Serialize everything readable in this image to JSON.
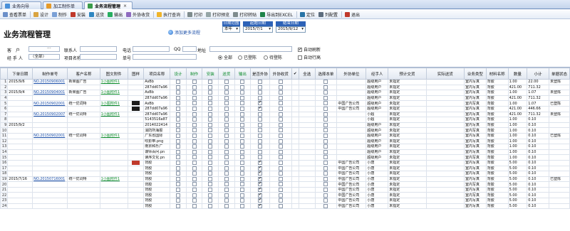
{
  "tabs": [
    {
      "label": "业务向导",
      "active": false
    },
    {
      "label": "加工制作单",
      "active": false
    },
    {
      "label": "业务流程管理",
      "active": true
    }
  ],
  "toolbar": [
    "查看票单",
    "设计",
    "制作",
    "安装",
    "送货",
    "输出",
    "外协收货",
    "执行查询",
    "打印",
    "打印预览",
    "打印转贴",
    "导出到EXCEL",
    "定位",
    "列配置",
    "退出"
  ],
  "header": {
    "title": "业务流程管理",
    "add_flow": "添加更多流程"
  },
  "date": {
    "range_label": "日期范围",
    "range_value": "本年",
    "start_label": "起始日期",
    "start_value": "2015/7/1",
    "end_label": "结束日期",
    "end_value": "2015/9/12"
  },
  "filters": {
    "customer_label": "客　户",
    "customer_value": "",
    "handler_label": "经 手 人",
    "handler_value": "〈全部〉",
    "contact_label": "联系人",
    "project_label": "项目名称",
    "phone_label": "电话",
    "order_label": "单号",
    "qq_label": "QQ",
    "address_label": "地址",
    "radio_all": "全部",
    "radio_signed": "已登陈",
    "radio_pending": "待登陈",
    "auto_refresh": "自动刷新",
    "auto_wrap": "自动行高",
    "ellipsis": "···"
  },
  "columns": [
    "",
    "下单日期",
    "制作单号",
    "客户名称",
    "图文附件",
    "图样",
    "项目名称",
    "设计",
    "制作",
    "安装",
    "送货",
    "输出",
    "是否外协",
    "外协收货",
    "✔",
    "全选",
    "选择本单",
    "外协单位",
    "经手人",
    "预计交货",
    "实际送货",
    "业务类型",
    "材料名称",
    "数量",
    "小计",
    "单据状态"
  ],
  "rows": [
    {
      "n": "1",
      "date": "2015/9/6",
      "order": "NO.20150906001",
      "cust": "新果图广告",
      "att": "1小图附件1",
      "thumb": "",
      "proj": "AsBb",
      "c": [
        0,
        0,
        0,
        0,
        0,
        0,
        0
      ],
      "sel": 0,
      "vendor": "",
      "handler": "超级用户",
      "eta": "未指定",
      "actual": "",
      "type": "室内写真",
      "mat": "背胶",
      "qty": "1.00",
      "sub": "22.00",
      "status": "未登陈"
    },
    {
      "n": "2",
      "date": "",
      "order": "",
      "cust": "",
      "att": "",
      "thumb": "",
      "proj": "287dd07a96",
      "c": [
        0,
        0,
        0,
        0,
        0,
        0,
        0
      ],
      "sel": 0,
      "vendor": "",
      "handler": "超级用户",
      "eta": "未指定",
      "actual": "",
      "type": "室内写真",
      "mat": "背胶",
      "qty": "421.00",
      "sub": "711.32",
      "status": ""
    },
    {
      "n": "3",
      "date": "2015/9/4",
      "order": "NO.20150904001",
      "cust": "新果图广告",
      "att": "1小图附件1",
      "thumb": "",
      "proj": "AsBb",
      "c": [
        0,
        0,
        0,
        0,
        0,
        0,
        0
      ],
      "sel": 0,
      "vendor": "",
      "handler": "超级用户",
      "eta": "未指定",
      "actual": "",
      "type": "室内写真",
      "mat": "背胶",
      "qty": "1.00",
      "sub": "1.07",
      "status": "未登陈"
    },
    {
      "n": "4",
      "date": "",
      "order": "",
      "cust": "",
      "att": "",
      "thumb": "",
      "proj": "287dd07a96",
      "c": [
        0,
        0,
        0,
        0,
        0,
        0,
        0
      ],
      "sel": 0,
      "vendor": "",
      "handler": "超级用户",
      "eta": "未指定",
      "actual": "",
      "type": "室内写真",
      "mat": "背胶",
      "qty": "421.00",
      "sub": "711.32",
      "status": ""
    },
    {
      "n": "5",
      "date": "",
      "order": "NO.20150902001",
      "cust": "统一优词特",
      "att": "1小图附件1",
      "thumb": "dark",
      "proj": "AsBb",
      "c": [
        0,
        0,
        0,
        0,
        0,
        1,
        0
      ],
      "sel": 0,
      "vendor": "中国广告公司",
      "handler": "超级用户",
      "eta": "未指定",
      "actual": "",
      "type": "室内写真",
      "mat": "背胶",
      "qty": "1.00",
      "sub": "1.07",
      "status": "已登陈"
    },
    {
      "n": "6",
      "date": "",
      "order": "",
      "cust": "",
      "att": "",
      "thumb": "dark",
      "proj": "287dd07a96",
      "c": [
        0,
        0,
        0,
        0,
        0,
        1,
        0
      ],
      "sel": 0,
      "vendor": "中国广告公司",
      "handler": "超级用户",
      "eta": "未指定",
      "actual": "",
      "type": "室内写真",
      "mat": "背胶",
      "qty": "421.00",
      "sub": "446.66",
      "status": ""
    },
    {
      "n": "7",
      "date": "",
      "order": "NO.20150902007",
      "cust": "统一优词特",
      "att": "1小图附件1",
      "thumb": "",
      "proj": "287dd07a96",
      "c": [
        0,
        0,
        0,
        0,
        0,
        0,
        0
      ],
      "sel": 0,
      "vendor": "",
      "handler": "小超",
      "eta": "未指定",
      "actual": "",
      "type": "室内写真",
      "mat": "背胶",
      "qty": "421.00",
      "sub": "711.32",
      "status": "未登陈"
    },
    {
      "n": "8",
      "date": "",
      "order": "",
      "cust": "",
      "att": "",
      "thumb": "",
      "proj": "5143516a87",
      "c": [
        0,
        0,
        0,
        0,
        0,
        0,
        0
      ],
      "sel": 0,
      "vendor": "",
      "handler": "小超",
      "eta": "未指定",
      "actual": "",
      "type": "室内写真",
      "mat": "背胶",
      "qty": "1.00",
      "sub": "0.10",
      "status": ""
    },
    {
      "n": "9",
      "date": "2015/9/2",
      "order": "",
      "cust": "",
      "att": "",
      "thumb": "",
      "proj": "2014022414",
      "c": [
        0,
        0,
        0,
        0,
        0,
        0,
        0
      ],
      "sel": 0,
      "vendor": "",
      "handler": "超级用户",
      "eta": "未指定",
      "actual": "",
      "type": "室内写真",
      "mat": "背胶",
      "qty": "1.00",
      "sub": "0.10",
      "status": ""
    },
    {
      "n": "10",
      "date": "",
      "order": "",
      "cust": "",
      "att": "",
      "thumb": "",
      "proj": "消防所海报",
      "c": [
        0,
        0,
        0,
        0,
        0,
        0,
        0
      ],
      "sel": 0,
      "vendor": "",
      "handler": "超级用户",
      "eta": "未指定",
      "actual": "",
      "type": "室内写真",
      "mat": "背胶",
      "qty": "1.00",
      "sub": "0.10",
      "status": ""
    },
    {
      "n": "11",
      "date": "",
      "order": "NO.20150902001",
      "cust": "统一优词特",
      "att": "1小图附件1",
      "thumb": "",
      "proj": "广东省国际",
      "c": [
        0,
        0,
        0,
        0,
        0,
        0,
        0
      ],
      "sel": 0,
      "vendor": "",
      "handler": "超级用户",
      "eta": "未指定",
      "actual": "",
      "type": "室内写真",
      "mat": "背胶",
      "qty": "1.00",
      "sub": "0.10",
      "status": "已登陈"
    },
    {
      "n": "12",
      "date": "",
      "order": "",
      "cust": "",
      "att": "",
      "thumb": "",
      "proj": "吹影带.png",
      "c": [
        0,
        0,
        0,
        0,
        0,
        0,
        0
      ],
      "sel": 0,
      "vendor": "",
      "handler": "超级用户",
      "eta": "未指定",
      "actual": "",
      "type": "室内写真",
      "mat": "背胶",
      "qty": "1.00",
      "sub": "0.10",
      "status": ""
    },
    {
      "n": "13",
      "date": "",
      "order": "",
      "cust": "",
      "att": "",
      "thumb": "",
      "proj": "南京和乐广",
      "c": [
        0,
        0,
        0,
        0,
        0,
        0,
        0
      ],
      "sel": 0,
      "vendor": "",
      "handler": "超级用户",
      "eta": "未指定",
      "actual": "",
      "type": "室内写真",
      "mat": "背胶",
      "qty": "1.00",
      "sub": "0.10",
      "status": ""
    },
    {
      "n": "14",
      "date": "",
      "order": "",
      "cust": "",
      "att": "",
      "thumb": "",
      "proj": "谋师百问.pn",
      "c": [
        0,
        0,
        0,
        0,
        0,
        0,
        0
      ],
      "sel": 0,
      "vendor": "",
      "handler": "超级用户",
      "eta": "未指定",
      "actual": "",
      "type": "室内写真",
      "mat": "背胶",
      "qty": "1.00",
      "sub": "0.10",
      "status": ""
    },
    {
      "n": "15",
      "date": "",
      "order": "",
      "cust": "",
      "att": "",
      "thumb": "",
      "proj": "读序文化.pn",
      "c": [
        0,
        0,
        0,
        0,
        0,
        0,
        0
      ],
      "sel": 0,
      "vendor": "",
      "handler": "超级用户",
      "eta": "未指定",
      "actual": "",
      "type": "室内写真",
      "mat": "背胶",
      "qty": "1.00",
      "sub": "0.10",
      "status": ""
    },
    {
      "n": "16",
      "date": "",
      "order": "",
      "cust": "",
      "att": "",
      "thumb": "red",
      "proj": "背胶",
      "c": [
        0,
        0,
        0,
        0,
        0,
        1,
        0
      ],
      "sel": 1,
      "vendor": "中国广告公司",
      "handler": "小唐",
      "eta": "未指定",
      "actual": "",
      "type": "室内写真",
      "mat": "背胶",
      "qty": "5.00",
      "sub": "0.10",
      "status": ""
    },
    {
      "n": "17",
      "date": "",
      "order": "",
      "cust": "",
      "att": "",
      "thumb": "",
      "proj": "背胶",
      "c": [
        0,
        0,
        0,
        0,
        0,
        1,
        0
      ],
      "sel": 1,
      "vendor": "中国广告公司",
      "handler": "小唐",
      "eta": "未指定",
      "actual": "",
      "type": "室内写真",
      "mat": "背胶",
      "qty": "5.00",
      "sub": "0.10",
      "status": ""
    },
    {
      "n": "18",
      "date": "",
      "order": "",
      "cust": "",
      "att": "",
      "thumb": "",
      "proj": "背胶",
      "c": [
        0,
        0,
        0,
        0,
        0,
        1,
        0
      ],
      "sel": 1,
      "vendor": "中国广告公司",
      "handler": "小唐",
      "eta": "未指定",
      "actual": "",
      "type": "室内写真",
      "mat": "背胶",
      "qty": "5.00",
      "sub": "0.10",
      "status": ""
    },
    {
      "n": "19",
      "date": "2015/7/16",
      "order": "NO.20150716001",
      "cust": "统一优词特",
      "att": "1小图附件1",
      "thumb": "",
      "proj": "背胶",
      "c": [
        0,
        0,
        0,
        0,
        0,
        1,
        0
      ],
      "sel": 1,
      "vendor": "中国广告公司",
      "handler": "小唐",
      "eta": "未指定",
      "actual": "",
      "type": "室内写真",
      "mat": "背胶",
      "qty": "5.00",
      "sub": "0.10",
      "status": "已登陈"
    },
    {
      "n": "20",
      "date": "",
      "order": "",
      "cust": "",
      "att": "",
      "thumb": "",
      "proj": "背胶",
      "c": [
        0,
        0,
        0,
        0,
        0,
        1,
        0
      ],
      "sel": 1,
      "vendor": "中国广告公司",
      "handler": "小唐",
      "eta": "未指定",
      "actual": "",
      "type": "室内写真",
      "mat": "背胶",
      "qty": "5.00",
      "sub": "0.10",
      "status": ""
    },
    {
      "n": "21",
      "date": "",
      "order": "",
      "cust": "",
      "att": "",
      "thumb": "",
      "proj": "背胶",
      "c": [
        0,
        0,
        0,
        0,
        0,
        1,
        0
      ],
      "sel": 1,
      "vendor": "中国广告公司",
      "handler": "小唐",
      "eta": "未指定",
      "actual": "",
      "type": "室内写真",
      "mat": "背胶",
      "qty": "5.00",
      "sub": "0.10",
      "status": ""
    },
    {
      "n": "22",
      "date": "",
      "order": "",
      "cust": "",
      "att": "",
      "thumb": "",
      "proj": "背胶",
      "c": [
        0,
        0,
        0,
        0,
        0,
        1,
        0
      ],
      "sel": 1,
      "vendor": "中国广告公司",
      "handler": "小唐",
      "eta": "未指定",
      "actual": "",
      "type": "室内写真",
      "mat": "背胶",
      "qty": "5.00",
      "sub": "0.10",
      "status": ""
    },
    {
      "n": "23",
      "date": "",
      "order": "",
      "cust": "",
      "att": "",
      "thumb": "",
      "proj": "背胶",
      "c": [
        0,
        0,
        0,
        0,
        0,
        1,
        0
      ],
      "sel": 1,
      "vendor": "中国广告公司",
      "handler": "小唐",
      "eta": "未指定",
      "actual": "",
      "type": "室内写真",
      "mat": "背胶",
      "qty": "5.00",
      "sub": "0.10",
      "status": ""
    },
    {
      "n": "24",
      "date": "",
      "order": "",
      "cust": "",
      "att": "",
      "thumb": "",
      "proj": "背胶",
      "c": [
        0,
        0,
        0,
        0,
        0,
        1,
        0
      ],
      "sel": 1,
      "vendor": "中国广告公司",
      "handler": "小唐",
      "eta": "未指定",
      "actual": "",
      "type": "室内写真",
      "mat": "背胶",
      "qty": "5.00",
      "sub": "0.10",
      "status": ""
    }
  ],
  "colors": {
    "accent": "#2d62b7",
    "link": "#1a4ea8",
    "green": "#0a8a2a",
    "header_bg": "#e2e8f1"
  }
}
